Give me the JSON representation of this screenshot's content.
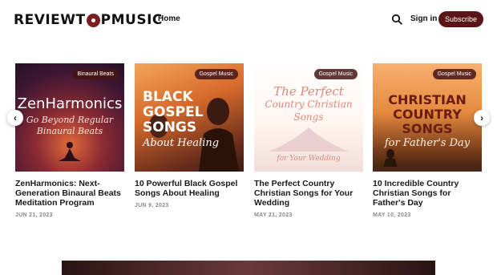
{
  "header": {
    "logo_parts": [
      "REVIEWT",
      "PMUSIC"
    ],
    "nav_home": "Home",
    "sign_in": "Sign in",
    "subscribe": "Subscribe",
    "search_icon": "search-icon"
  },
  "cards": [
    {
      "tag": "Binaural Beats",
      "art_line1": "ZenHarmonics",
      "art_line2": "Go Beyond Regular",
      "art_line3": "Binaural Beats",
      "title": "ZenHarmonics: Next-Generation Binaural Beats Meditation Program",
      "date": "JUN 21, 2023"
    },
    {
      "tag": "Gospel Music",
      "art_line1": "BLACK",
      "art_line2": "GOSPEL",
      "art_line3": "SONGS",
      "art_line4": "About Healing",
      "title": "10 Powerful Black Gospel Songs About Healing",
      "date": "JUN 9, 2023"
    },
    {
      "tag": "Gospel Music",
      "art_line1": "The Perfect",
      "art_line2": "Country Christian",
      "art_line3": "Songs",
      "art_line4": "for Your Wedding",
      "title": "The Perfect Country Christian Songs for Your Wedding",
      "date": "MAY 21, 2023"
    },
    {
      "tag": "Gospel Music",
      "art_line1": "CHRISTIAN",
      "art_line2": "COUNTRY",
      "art_line3": "SONGS",
      "art_line4": "for Father's Day",
      "title": "10 Incredible Country Christian Songs for Father's Day",
      "date": "MAY 10, 2023"
    }
  ],
  "carousel": {
    "prev_icon": "chevron-left-icon",
    "next_icon": "chevron-right-icon"
  },
  "colors": {
    "brand": "#5a1616",
    "date_gray": "#8a8a8a"
  }
}
